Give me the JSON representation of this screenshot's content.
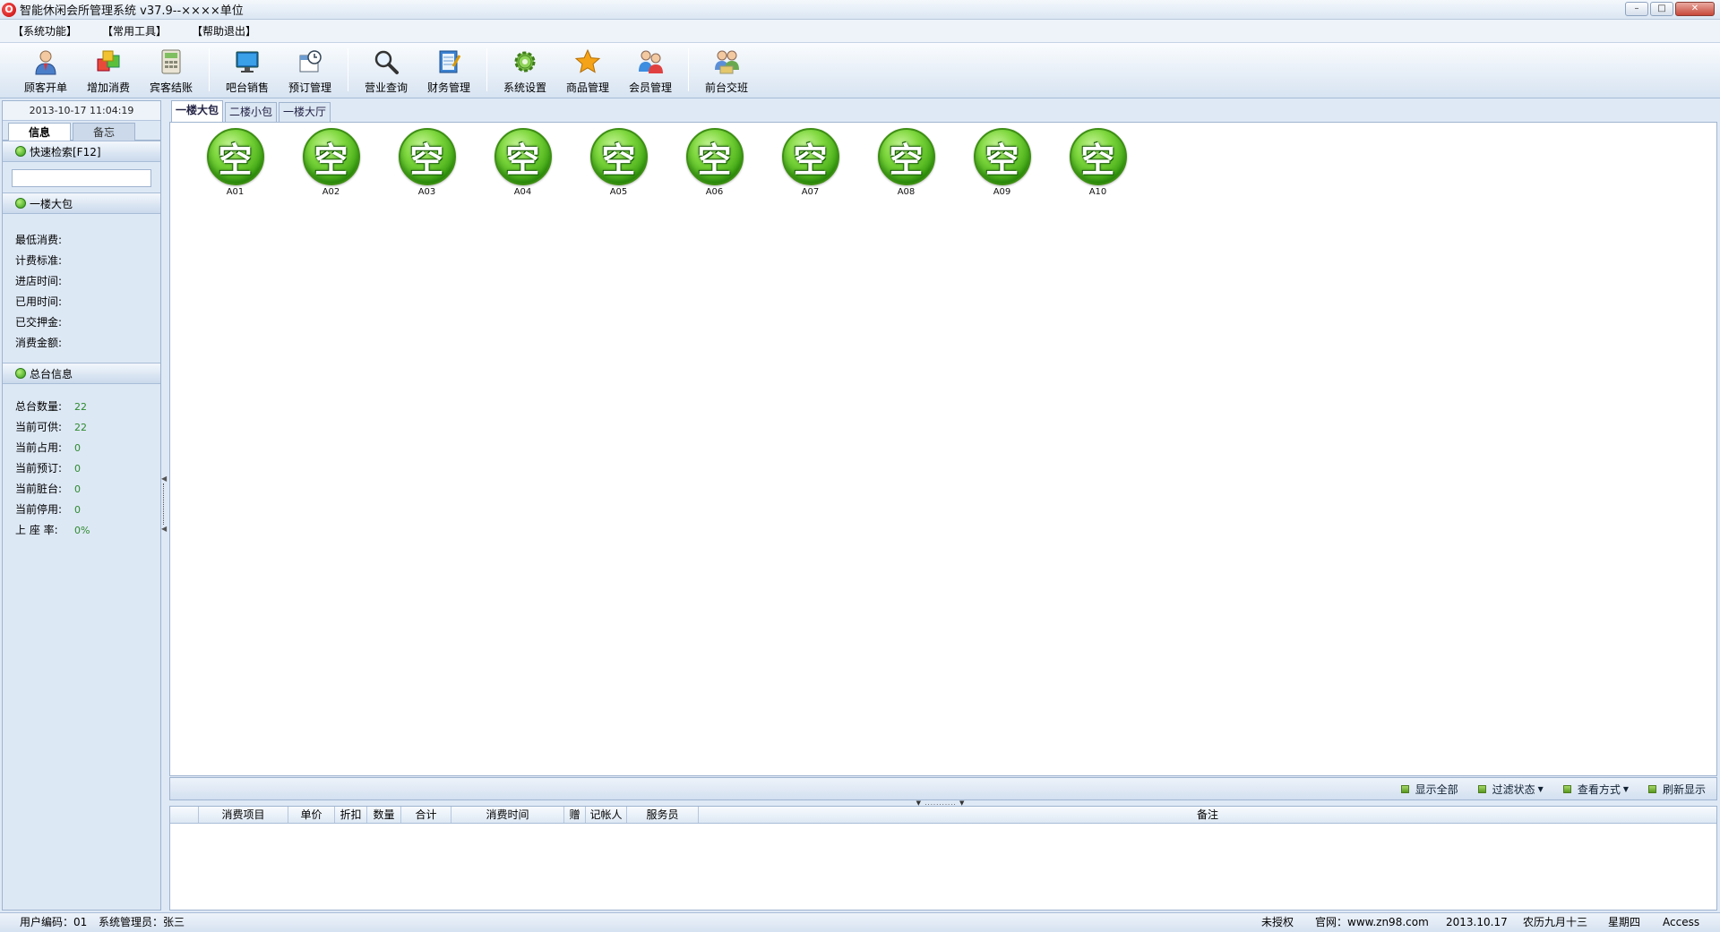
{
  "window": {
    "title": "智能休闲会所管理系统 v37.9--××××单位",
    "minimize": "–",
    "maximize": "□",
    "close": "✕"
  },
  "menu": [
    "【系统功能】",
    "【常用工具】",
    "【帮助退出】"
  ],
  "toolbar": [
    {
      "label": "顾客开单",
      "icon": "customer-icon"
    },
    {
      "label": "增加消费",
      "icon": "add-consumption-icon"
    },
    {
      "label": "宾客结账",
      "icon": "calculator-icon"
    },
    {
      "label": "吧台销售",
      "icon": "monitor-icon"
    },
    {
      "label": "预订管理",
      "icon": "calendar-clock-icon"
    },
    {
      "label": "营业查询",
      "icon": "magnifier-icon"
    },
    {
      "label": "财务管理",
      "icon": "notepad-icon"
    },
    {
      "label": "系统设置",
      "icon": "gear-icon"
    },
    {
      "label": "商品管理",
      "icon": "star-icon"
    },
    {
      "label": "会员管理",
      "icon": "members-icon"
    },
    {
      "label": "前台交班",
      "icon": "handover-icon"
    }
  ],
  "left": {
    "datetime": "2013-10-17  11:04:19",
    "tabs": [
      "信息",
      "备忘"
    ],
    "quick_search": "快速检索[F12]",
    "search_value": "",
    "room_section": "一楼大包",
    "room_info": [
      {
        "label": "最低消费:",
        "value": ""
      },
      {
        "label": "计费标准:",
        "value": ""
      },
      {
        "label": "进店时间:",
        "value": ""
      },
      {
        "label": "已用时间:",
        "value": ""
      },
      {
        "label": "已交押金:",
        "value": ""
      },
      {
        "label": "消费金额:",
        "value": ""
      }
    ],
    "total_section": "总台信息",
    "total_info": [
      {
        "label": "总台数量:",
        "value": "22"
      },
      {
        "label": "当前可供:",
        "value": "22"
      },
      {
        "label": "当前占用:",
        "value": "0"
      },
      {
        "label": "当前预订:",
        "value": "0"
      },
      {
        "label": "当前脏台:",
        "value": "0"
      },
      {
        "label": "当前停用:",
        "value": "0"
      },
      {
        "label": "上 座 率:",
        "value": "0%"
      }
    ]
  },
  "main_tabs": [
    "一楼大包",
    "二楼小包",
    "一楼大厅"
  ],
  "rooms": [
    {
      "status": "空",
      "name": "A01"
    },
    {
      "status": "空",
      "name": "A02"
    },
    {
      "status": "空",
      "name": "A03"
    },
    {
      "status": "空",
      "name": "A04"
    },
    {
      "status": "空",
      "name": "A05"
    },
    {
      "status": "空",
      "name": "A06"
    },
    {
      "status": "空",
      "name": "A07"
    },
    {
      "status": "空",
      "name": "A08"
    },
    {
      "status": "空",
      "name": "A09"
    },
    {
      "status": "空",
      "name": "A10"
    }
  ],
  "consume_toolbar": [
    {
      "label": "显示全部",
      "dropdown": false
    },
    {
      "label": "过滤状态",
      "dropdown": true
    },
    {
      "label": "查看方式",
      "dropdown": true
    },
    {
      "label": "刷新显示",
      "dropdown": false
    }
  ],
  "grid_columns": [
    "",
    "消费项目",
    "单价",
    "折扣",
    "数量",
    "合计",
    "消费时间",
    "赠",
    "记帐人",
    "服务员",
    "备注"
  ],
  "status": {
    "user_code": "用户编码：01",
    "operator": "系统管理员：张三",
    "license": "未授权",
    "website": "官网：www.zn98.com",
    "date": "2013.10.17",
    "lunar": "农历九月十三",
    "weekday": "星期四",
    "db": "Access"
  },
  "colors": {
    "accent": "#dfe9f6",
    "room_free": "#4cb81a",
    "value_green": "#2d8a2d"
  }
}
